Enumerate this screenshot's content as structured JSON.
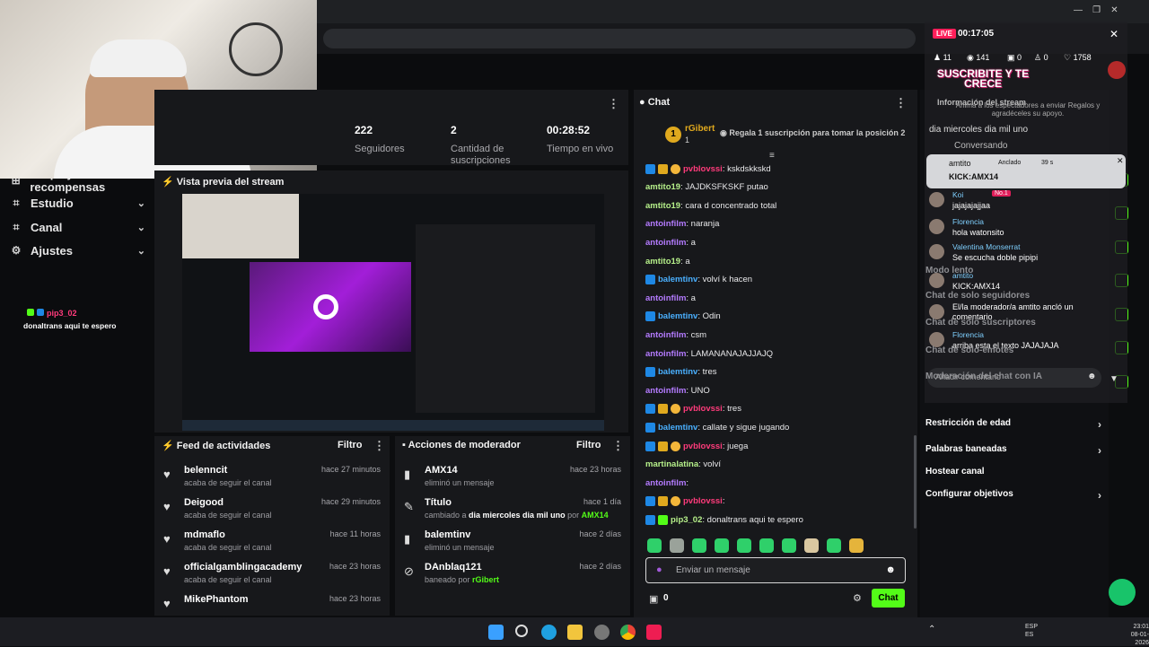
{
  "stats": {
    "followers_value": "222",
    "followers_label": "Seguidores",
    "subs_value": "2",
    "subs_label": "Cantidad de suscripciones",
    "live_value": "00:28:52",
    "live_label": "Tiempo en vivo"
  },
  "sidebar": {
    "items": [
      {
        "label": "Drops y recompensas",
        "icon": "gift-icon"
      },
      {
        "label": "Estudio",
        "icon": "studio-icon"
      },
      {
        "label": "Canal",
        "icon": "channel-icon"
      },
      {
        "label": "Ajustes",
        "icon": "settings-icon"
      }
    ]
  },
  "overlay_chat": {
    "user": "pip3_02",
    "message": "donaltrans aqui te espero"
  },
  "preview": {
    "title": "Vista previa del stream"
  },
  "chat": {
    "title": "Chat",
    "leader_rank": "1",
    "leader_name": "rGibert",
    "leader_count": "1",
    "promo": "Regala 1 suscripción para tomar la posición 2",
    "messages": [
      {
        "user": "pvblovssi",
        "cls": "u-red",
        "badges": [
          "b-blue",
          "b-gold",
          "b-gold2"
        ],
        "text": ": kskdskkskd"
      },
      {
        "user": "amtito19",
        "cls": "u-green",
        "badges": [],
        "text": ": JAJDKSFKSKF putao"
      },
      {
        "user": "amtito19",
        "cls": "u-green",
        "badges": [],
        "text": ": cara d concentrado total"
      },
      {
        "user": "antoinfilm",
        "cls": "u-purple",
        "badges": [],
        "text": ": naranja"
      },
      {
        "user": "antoinfilm",
        "cls": "u-purple",
        "badges": [],
        "text": ": a"
      },
      {
        "user": "amtito19",
        "cls": "u-green",
        "badges": [],
        "text": ": a"
      },
      {
        "user": "balemtinv",
        "cls": "u-blue",
        "badges": [
          "b-blue"
        ],
        "text": ": volví k hacen"
      },
      {
        "user": "antoinfilm",
        "cls": "u-purple",
        "badges": [],
        "text": ": a"
      },
      {
        "user": "balemtinv",
        "cls": "u-blue",
        "badges": [
          "b-blue"
        ],
        "text": ": Odin"
      },
      {
        "user": "antoinfilm",
        "cls": "u-purple",
        "badges": [],
        "text": ": csm"
      },
      {
        "user": "antoinfilm",
        "cls": "u-purple",
        "badges": [],
        "text": ": LAMANANAJAJJAJQ"
      },
      {
        "user": "balemtinv",
        "cls": "u-blue",
        "badges": [
          "b-blue"
        ],
        "text": ": tres"
      },
      {
        "user": "antoinfilm",
        "cls": "u-purple",
        "badges": [],
        "text": ": UNO"
      },
      {
        "user": "pvblovssi",
        "cls": "u-red",
        "badges": [
          "b-blue",
          "b-gold",
          "b-gold2"
        ],
        "text": ": tres"
      },
      {
        "user": "balemtinv",
        "cls": "u-blue",
        "badges": [
          "b-blue"
        ],
        "text": ": callate y sigue jugando"
      },
      {
        "user": "pvblovssi",
        "cls": "u-red",
        "badges": [
          "b-blue",
          "b-gold",
          "b-gold2"
        ],
        "text": ": juega"
      },
      {
        "user": "martinalatina",
        "cls": "u-green",
        "badges": [],
        "text": ": volví"
      },
      {
        "user": "antoinfilm",
        "cls": "u-purple",
        "badges": [],
        "text": ":"
      },
      {
        "user": "pvblovssi",
        "cls": "u-red",
        "badges": [
          "b-blue",
          "b-gold",
          "b-gold2"
        ],
        "text": ":"
      },
      {
        "user": "pip3_02",
        "cls": "u-green",
        "badges": [
          "b-blue",
          "b-green"
        ],
        "text": ": donaltrans aqui te espero"
      }
    ],
    "input_placeholder": "Enviar un mensaje",
    "points": "0",
    "send_label": "Chat"
  },
  "feed": {
    "title": "Feed de actividades",
    "filter": "Filtro",
    "rows": [
      {
        "name": "belenncit",
        "sub": "acaba de seguir el canal",
        "time": "hace 27 minutos"
      },
      {
        "name": "Deigood",
        "sub": "acaba de seguir el canal",
        "time": "hace 29 minutos"
      },
      {
        "name": "mdmaflo",
        "sub": "acaba de seguir el canal",
        "time": "hace 11 horas"
      },
      {
        "name": "officialgamblingacademy",
        "sub": "acaba de seguir el canal",
        "time": "hace 23 horas"
      },
      {
        "name": "MikePhantom",
        "sub": "",
        "time": "hace 23 horas"
      }
    ]
  },
  "mod": {
    "title": "Acciones de moderador",
    "filter": "Filtro",
    "rows": [
      {
        "name": "AMX14",
        "sub": "eliminó un mensaje",
        "time": "hace 23 horas",
        "icon": "trash-icon"
      },
      {
        "name": "Título",
        "sub": "cambiado a ",
        "sub_bold": "dia miercoles dia mil uno",
        "sub_by": " por ",
        "sub_user": "AMX14",
        "time": "hace 1 día",
        "icon": "edit-title-icon"
      },
      {
        "name": "balemtinv",
        "sub": "eliminó un mensaje",
        "time": "hace 2 días",
        "icon": "trash-icon"
      },
      {
        "name": "DAnblaq121",
        "sub": "baneado por ",
        "sub_user": "rGibert",
        "time": "hace 2 días",
        "icon": "ban-icon"
      }
    ]
  },
  "right_panel": {
    "stream_info": "Información del stream",
    "title_line": "dia miercoles dia mil uno",
    "category": "Conversando",
    "rows": [
      "Restricción de edad",
      "Palabras baneadas",
      "Hostear canal",
      "Configurar objetivos"
    ]
  },
  "overlay": {
    "live": "LIVE",
    "timer": "00:17:05",
    "stats": [
      "11",
      "141",
      "0",
      "0",
      "1758"
    ],
    "banner": "SUSCRIBITE Y TE CRECE",
    "hint": "Anima a los espectadores a enviar Regalos y agradéceles su apoyo.",
    "pinned_user": "amtito",
    "pinned_tag": "Anclado",
    "pinned_age": "39 s",
    "pinned_msg": "KICK:AMX14",
    "messages": [
      {
        "user": "Koi",
        "tag": "No.1",
        "text": "jajajajajjaa"
      },
      {
        "user": "Florencia",
        "tag": "",
        "text": "hola watonsito"
      },
      {
        "user": "Valentina Monserrat",
        "tag": "",
        "text": "Se escucha doble pipipi"
      },
      {
        "user": "amtito",
        "tag": "",
        "text": "KICK:AMX14"
      },
      {
        "user": "",
        "tag": "",
        "text": "El/la moderador/a amtito ancló un comentario"
      },
      {
        "user": "Florencia",
        "tag": "",
        "text": "arriba esta el texto JAJAJAJA"
      }
    ],
    "comment_placeholder": "Añadir comentario",
    "bg_rows": [
      "Modo lento",
      "Chat de solo seguidores",
      "Chat de solo suscriptores",
      "Chat de solo-emotes",
      "Moderación del chat con IA"
    ]
  },
  "taskbar": {
    "lang1": "ESP",
    "lang2": "ES",
    "time": "23:01",
    "date": "08-01-2026"
  }
}
